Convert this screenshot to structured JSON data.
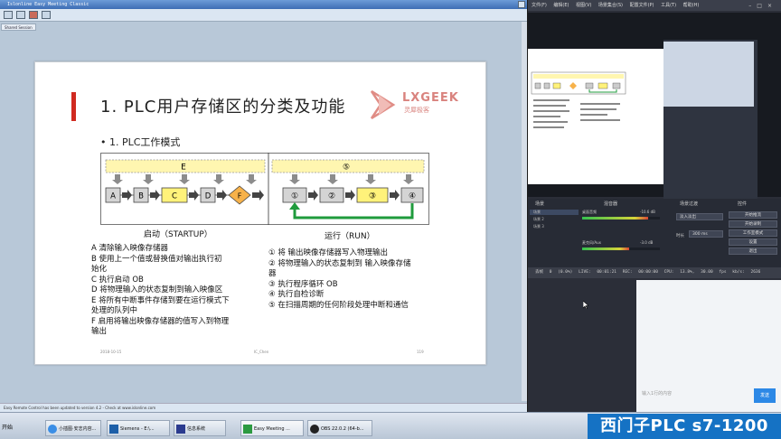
{
  "isl": {
    "title": "Islonline Easy Meeting Classic",
    "tab": "Shared Session",
    "status": "Easy Remote Control has been updated to version 4.2 - Check at www.islonline.com"
  },
  "slide": {
    "title": "1. PLC用户存储区的分类及功能",
    "logo_text": "LXGEEK",
    "logo_sub": "灵犀极客",
    "bullet": "• 1. PLC工作模式",
    "diagram": {
      "startup_box_E": "E",
      "run_box_5": "⑤",
      "startup_steps": [
        "A",
        "B",
        "C",
        "D",
        "F"
      ],
      "run_steps": [
        "①",
        "②",
        "③",
        "④"
      ]
    },
    "startup_label": "启动（STARTUP）",
    "run_label": "运行（RUN）",
    "startup_notes": [
      "A  清除输入映像存储器",
      "B  使用上一个值或替换值对输出执行初",
      "始化",
      "C  执行启动 OB",
      "D  将物理输入的状态复制到输入映像区",
      "E  将所有中断事件存储到要在运行模式下",
      "处理的队列中",
      "F  启用将输出映像存储器的值写入到物理",
      "输出"
    ],
    "run_notes": [
      "① 将 输出映像存储器写入物理输出",
      "② 将物理输入的状态复制到 输入映像存储",
      "器",
      "③ 执行程序循环 OB",
      "④ 执行自检诊断",
      "⑤ 在扫描周期的任何阶段处理中断和通信"
    ],
    "footer_date": "2018-10-15",
    "footer_mid": "IC_Chen",
    "footer_page": "119"
  },
  "obs": {
    "menu": "文件(F) 编辑(E) 视图(V) 场景集合(S) 配置文件(P) 工具(T) 帮助(H)",
    "panels": {
      "scenes": "场景",
      "sources": "来源",
      "mixer": "混音器",
      "transitions": "场景过渡",
      "controls": "控件"
    },
    "scene_items": [
      "场景",
      "场景 2",
      "场景 3"
    ],
    "mixer_rows": [
      {
        "name": "桌面音频",
        "db": "-10.6 dB",
        "level": 0.85
      },
      {
        "name": "麦克风/Aux",
        "db": "-3.0 dB",
        "level": 0.6
      }
    ],
    "transition_value": "淡入淡出",
    "duration_label": "时长",
    "duration_value": "300 ms",
    "controls": [
      "开始推流",
      "开始录制",
      "工作室模式",
      "设置",
      "退出"
    ],
    "status_text": "丢帧 0 (0.0%)   LIVE: 00:01:21   REC: 00:00:00   CPU: 13.8%, 30.00 fps   kb/s: 2636",
    "chat_placeholder": "输入1行的内容",
    "send_label": "发送"
  },
  "banner": "西门子PLC s7-1200",
  "taskbar": {
    "start": "开始",
    "items": [
      "小插图·安志内容...",
      "Siemens - E:\\...",
      "信息系统",
      "Easy Meeting ...",
      "OBS 22.0.2 (64-b..."
    ]
  },
  "colors": {
    "accent_red": "#d02a20",
    "logo_pink": "#d9837e",
    "step_yellow": "#fff27a",
    "step_gray": "#d4d4d4",
    "run_arrow_green": "#1f9b3c",
    "banner_blue": "#1572c4"
  }
}
